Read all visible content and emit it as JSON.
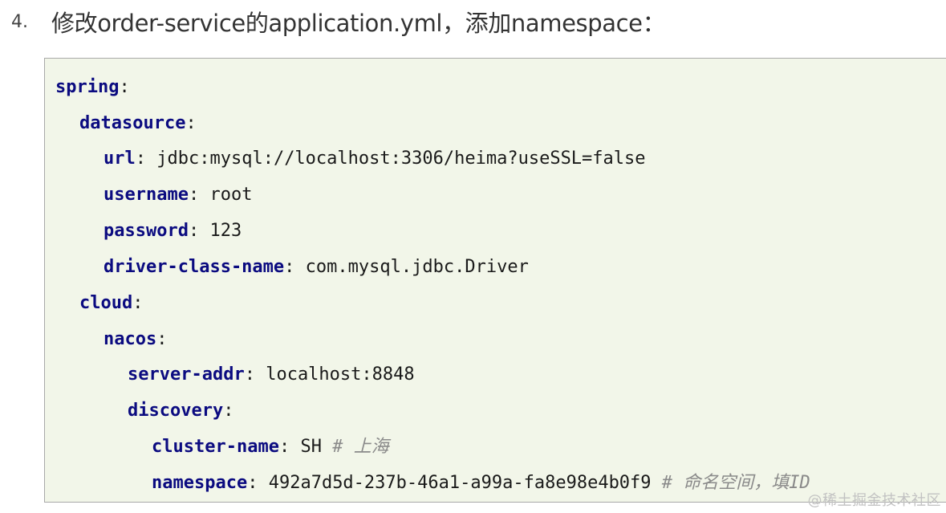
{
  "step": {
    "number": "4.",
    "text": "修改order-service的application.yml，添加namespace："
  },
  "code": {
    "language": "yaml",
    "lines": [
      {
        "key": "spring",
        "value": "",
        "comment": ""
      },
      {
        "key": "datasource",
        "value": "",
        "comment": ""
      },
      {
        "key": "url",
        "value": "jdbc:mysql://localhost:3306/heima?useSSL=false",
        "comment": ""
      },
      {
        "key": "username",
        "value": "root",
        "comment": ""
      },
      {
        "key": "password",
        "value": "123",
        "comment": ""
      },
      {
        "key": "driver-class-name",
        "value": "com.mysql.jdbc.Driver",
        "comment": ""
      },
      {
        "key": "cloud",
        "value": "",
        "comment": ""
      },
      {
        "key": "nacos",
        "value": "",
        "comment": ""
      },
      {
        "key": "server-addr",
        "value": "localhost:8848",
        "comment": ""
      },
      {
        "key": "discovery",
        "value": "",
        "comment": ""
      },
      {
        "key": "cluster-name",
        "value": "SH",
        "comment": "# 上海"
      },
      {
        "key": "namespace",
        "value": "492a7d5d-237b-46a1-a99a-fa8e98e4b0f9",
        "comment": "# 命名空间，填ID"
      }
    ]
  },
  "watermark": "@稀土掘金技术社区",
  "colors": {
    "code_background": "#f2f6e9",
    "key": "#0b0b80",
    "comment": "#8a8a8a",
    "border": "#a9a9a9"
  }
}
